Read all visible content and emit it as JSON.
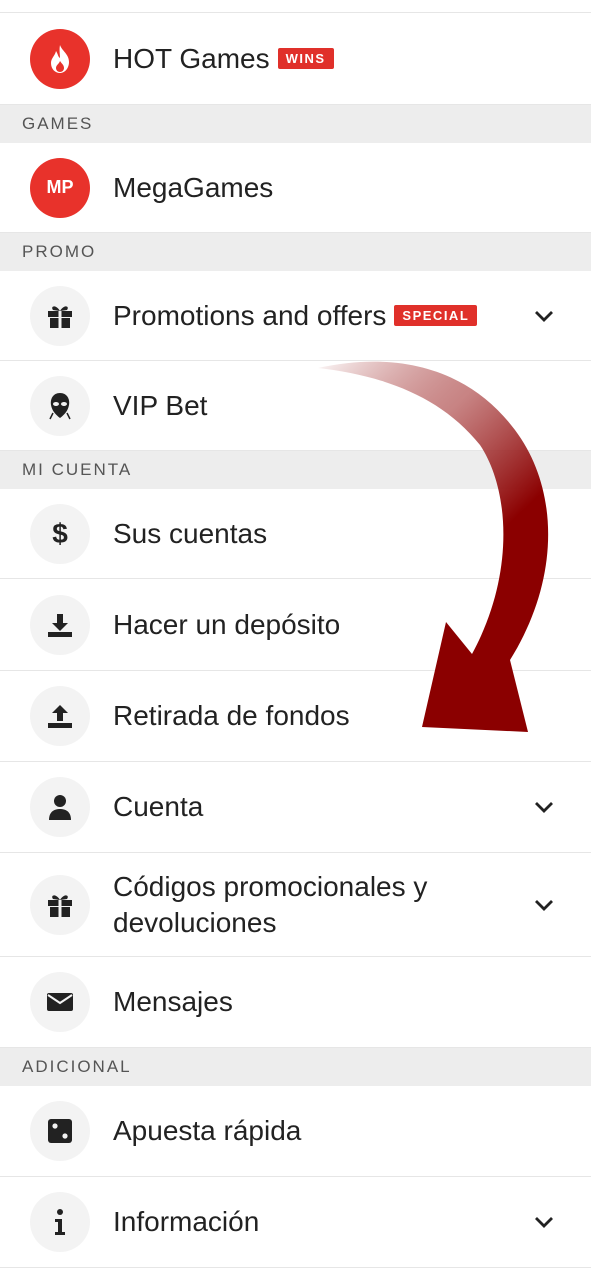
{
  "hot_games": {
    "label": "HOT Games",
    "badge": "WINS"
  },
  "sections": {
    "games": "GAMES",
    "promo": "PROMO",
    "mi_cuenta": "MI CUENTA",
    "adicional": "ADICIONAL"
  },
  "megagames": {
    "label": "MegaGames",
    "icon_text": "MP"
  },
  "promotions": {
    "label": "Promotions and offers",
    "badge": "SPECIAL"
  },
  "vip_bet": {
    "label": "VIP Bet"
  },
  "sus_cuentas": {
    "label": "Sus cuentas"
  },
  "deposito": {
    "label": "Hacer un depósito"
  },
  "retirada": {
    "label": "Retirada de fondos"
  },
  "cuenta": {
    "label": "Cuenta"
  },
  "codigos": {
    "label_line1": "Códigos promocionales y",
    "label_line2": "devoluciones"
  },
  "mensajes": {
    "label": "Mensajes"
  },
  "apuesta": {
    "label": "Apuesta rápida"
  },
  "informacion": {
    "label": "Información"
  },
  "colors": {
    "accent_red": "#e8322b",
    "arrow_dark_red": "#8b0000"
  }
}
